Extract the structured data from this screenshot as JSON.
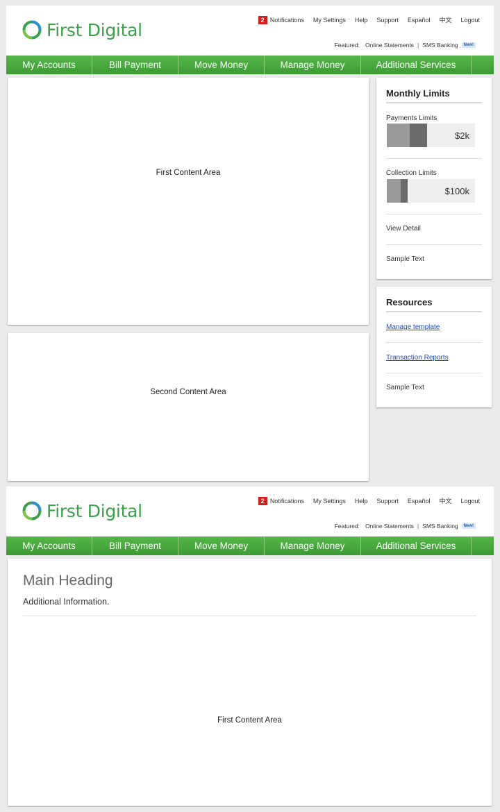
{
  "brand": {
    "name": "First Digital"
  },
  "toplinks": {
    "notification_count": "2",
    "notifications": "Notifications",
    "settings": "My Settings",
    "help": "Help",
    "support": "Support",
    "espanol": "Español",
    "chinese": "中文",
    "logout": "Logout"
  },
  "featured": {
    "label": "Featured:",
    "link1": "Online Statements",
    "link2": "SMS Banking",
    "new_tag": "New!"
  },
  "nav": [
    "My Accounts",
    "Bill Payment",
    "Move Money",
    "Manage Money",
    "Additional Services"
  ],
  "content": {
    "first": "First Content Area",
    "second": "Second Content Area"
  },
  "limits": {
    "title": "Monthly Limits",
    "payments_label": "Payments Limits",
    "payments_amount": "$2k",
    "payments_used_fraction": 0.26,
    "payments_pending_fraction": 0.2,
    "collection_label": "Collection Limits",
    "collection_amount": "$100k",
    "collection_used_fraction": 0.16,
    "collection_pending_fraction": 0.08,
    "view_detail": "View Detail",
    "sample": "Sample Text"
  },
  "resources": {
    "title": "Resources",
    "link1": "Manage template",
    "link2": "Transaction Reports",
    "sample": "Sample Text"
  },
  "main": {
    "heading": "Main Heading",
    "info": "Additional Information.",
    "content": "First Content Area"
  },
  "colors": {
    "brand_green": "#3aa14a",
    "badge_red": "#d21f1f",
    "link_blue": "#1a4fbf"
  }
}
